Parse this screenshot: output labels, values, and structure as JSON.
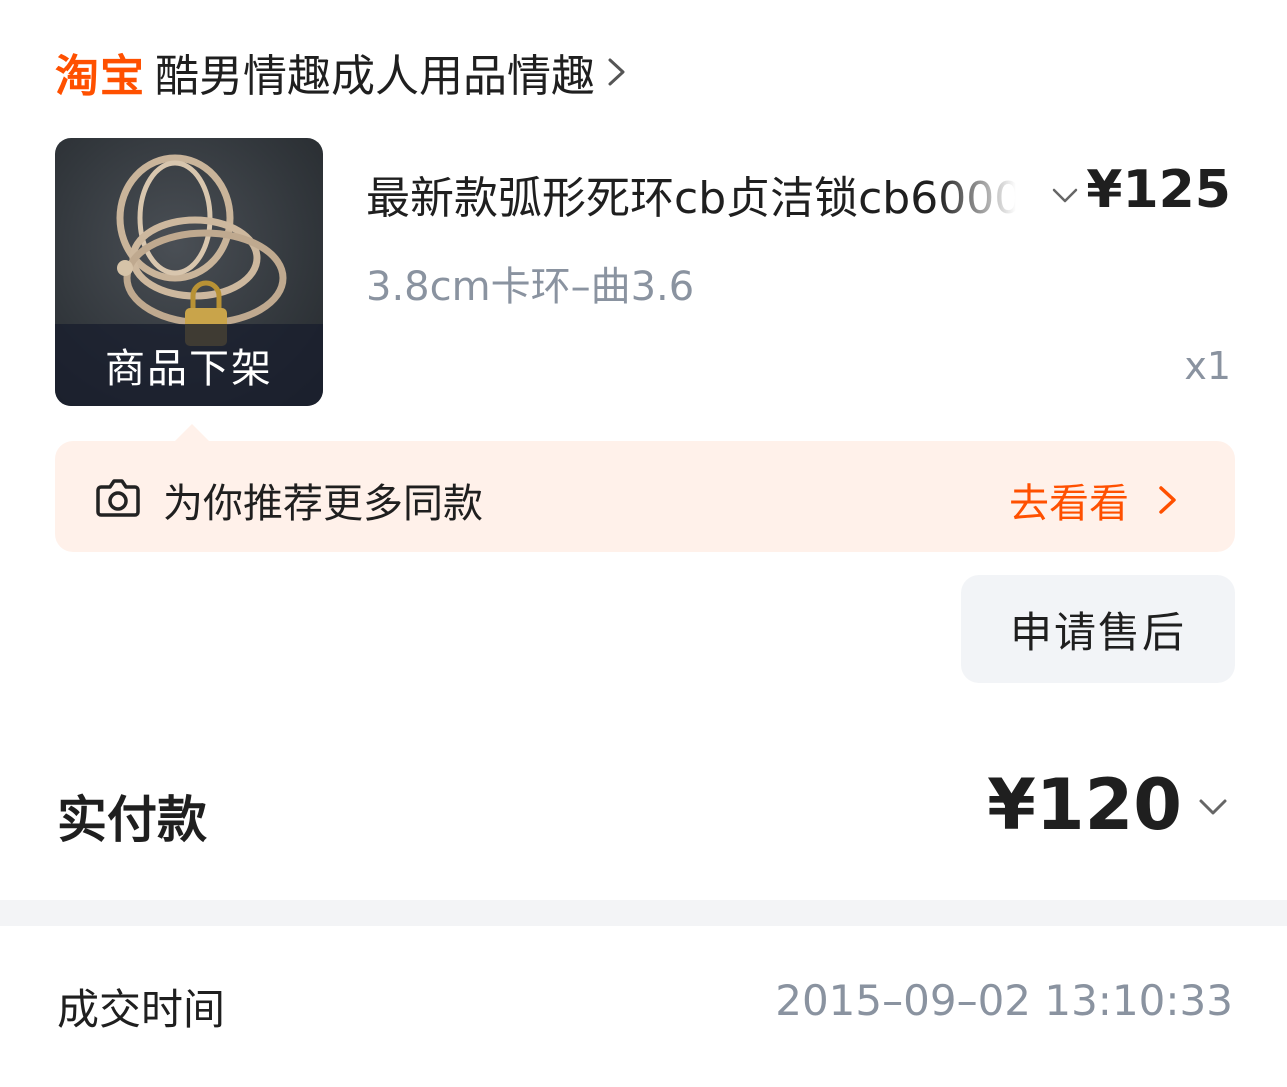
{
  "shop": {
    "logo_text": "淘宝",
    "name": "酷男情趣成人用品情趣",
    "brand_color": "#ff5000"
  },
  "item": {
    "thumbnail_alt": "chastity cage product photo",
    "status_overlay": "商品下架",
    "title": "最新款弧形死环cb贞洁锁cb6000",
    "price": "¥125",
    "sku": "3.8cm卡环–曲3.6",
    "quantity": "x1"
  },
  "recommend": {
    "icon": "camera-icon",
    "text": "为你推荐更多同款",
    "link_label": "去看看"
  },
  "actions": {
    "after_sale_label": "申请售后"
  },
  "payment": {
    "label": "实付款",
    "amount": "¥120"
  },
  "order_info": {
    "deal_time_label": "成交时间",
    "deal_time_value": "2015–09–02 13:10:33"
  },
  "colors": {
    "accent": "#ff5000",
    "muted_text": "#8a93a0",
    "recommend_bg": "#fff1ea",
    "button_bg": "#f2f4f7"
  }
}
